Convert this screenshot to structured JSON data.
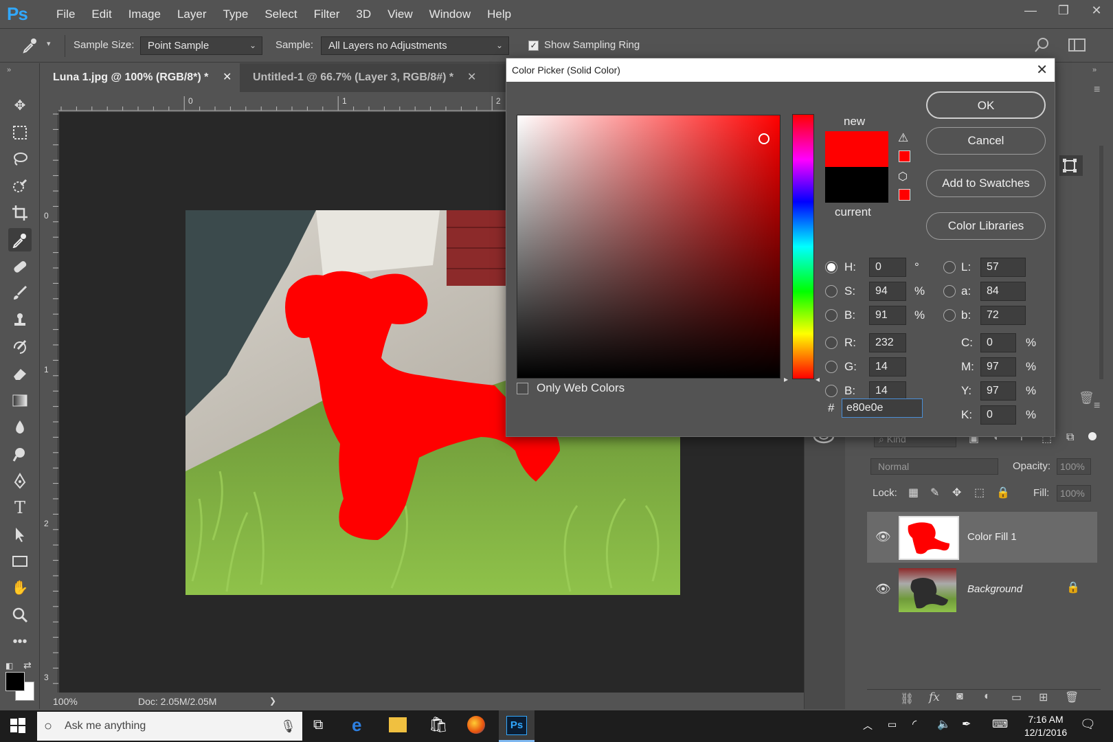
{
  "app": {
    "logo": "Ps",
    "menu": [
      "File",
      "Edit",
      "Image",
      "Layer",
      "Type",
      "Select",
      "Filter",
      "3D",
      "View",
      "Window",
      "Help"
    ],
    "window_controls": [
      "—",
      "❐",
      "✕"
    ]
  },
  "options": {
    "sample_size_label": "Sample Size:",
    "sample_size_value": "Point Sample",
    "sample_label": "Sample:",
    "sample_value": "All Layers no Adjustments",
    "show_ring_label": "Show Sampling Ring",
    "show_ring_checked": true
  },
  "tabs": [
    {
      "label": "Luna 1.jpg @ 100% (RGB/8*) *",
      "active": true
    },
    {
      "label": "Untitled-1 @ 66.7% (Layer 3, RGB/8#) *",
      "active": false
    }
  ],
  "ruler": {
    "top": [
      "0",
      "1",
      "2"
    ],
    "left": [
      "0",
      "1",
      "2",
      "3"
    ]
  },
  "status": {
    "zoom": "100%",
    "doc": "Doc: 2.05M/2.05M",
    "arrow": "❯"
  },
  "layers_panel": {
    "kind_label": "Kind",
    "blend_mode": "Normal",
    "opacity_label": "Opacity:",
    "opacity_value": "100%",
    "lock_label": "Lock:",
    "fill_label": "Fill:",
    "fill_value": "100%",
    "layers": [
      {
        "name": "Color Fill 1",
        "selected": true
      },
      {
        "name": "Background",
        "selected": false
      }
    ]
  },
  "taskbar": {
    "search_placeholder": "Ask me anything",
    "time": "7:16 AM",
    "date": "12/1/2016"
  },
  "dialog": {
    "title": "Color Picker (Solid Color)",
    "close": "✕",
    "new_label": "new",
    "current_label": "current",
    "new_color": "#ff0000",
    "current_color": "#000000",
    "buttons": {
      "ok": "OK",
      "cancel": "Cancel",
      "add_swatches": "Add to Swatches",
      "color_libraries": "Color Libraries"
    },
    "only_web_colors": "Only Web Colors",
    "hsb": {
      "h": {
        "label": "H:",
        "value": "0",
        "unit": "°"
      },
      "s": {
        "label": "S:",
        "value": "94",
        "unit": "%"
      },
      "b": {
        "label": "B:",
        "value": "91",
        "unit": "%"
      }
    },
    "rgb": {
      "r": {
        "label": "R:",
        "value": "232"
      },
      "g": {
        "label": "G:",
        "value": "14"
      },
      "b": {
        "label": "B:",
        "value": "14"
      }
    },
    "lab": {
      "l": {
        "label": "L:",
        "value": "57"
      },
      "a": {
        "label": "a:",
        "value": "84"
      },
      "b": {
        "label": "b:",
        "value": "72"
      }
    },
    "cmyk": {
      "c": {
        "label": "C:",
        "value": "0",
        "unit": "%"
      },
      "m": {
        "label": "M:",
        "value": "97",
        "unit": "%"
      },
      "y": {
        "label": "Y:",
        "value": "97",
        "unit": "%"
      },
      "k": {
        "label": "K:",
        "value": "0",
        "unit": "%"
      }
    },
    "hex_label": "#",
    "hex_value": "e80e0e"
  }
}
